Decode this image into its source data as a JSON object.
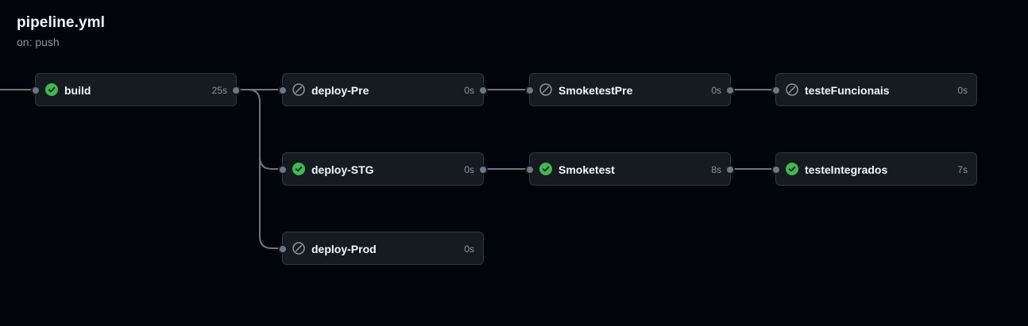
{
  "header": {
    "title": "pipeline.yml",
    "subtitle": "on: push"
  },
  "jobs": [
    {
      "name": "build",
      "duration": "25s",
      "status": "success"
    },
    {
      "name": "deploy-Pre",
      "duration": "0s",
      "status": "skipped"
    },
    {
      "name": "SmoketestPre",
      "duration": "0s",
      "status": "skipped"
    },
    {
      "name": "testeFuncionais",
      "duration": "0s",
      "status": "skipped"
    },
    {
      "name": "deploy-STG",
      "duration": "0s",
      "status": "success"
    },
    {
      "name": "Smoketest",
      "duration": "8s",
      "status": "success"
    },
    {
      "name": "testeIntegrados",
      "duration": "7s",
      "status": "success"
    },
    {
      "name": "deploy-Prod",
      "duration": "0s",
      "status": "skipped"
    }
  ],
  "colors": {
    "success": "#3fb950",
    "skipped": "#8b949e",
    "connector": "#6e7681"
  },
  "icons": {
    "success": "check-circle-fill-icon",
    "skipped": "skip-circle-icon"
  }
}
